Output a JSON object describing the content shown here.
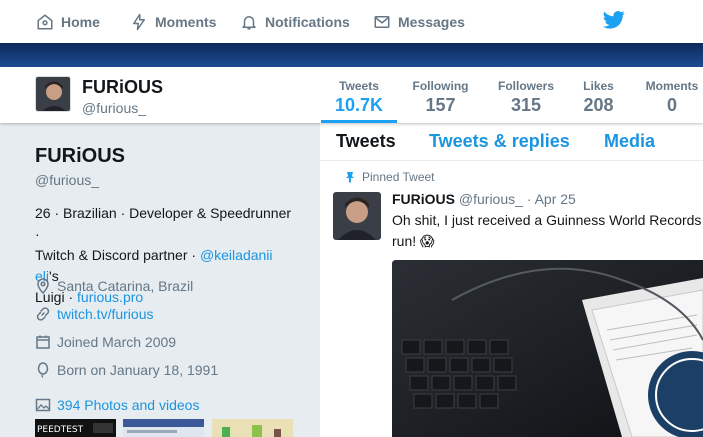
{
  "topnav": {
    "home": "Home",
    "moments": "Moments",
    "notifications": "Notifications",
    "messages": "Messages"
  },
  "profile_nav": {
    "name": "FURiOUS",
    "handle": "@furious_",
    "stats": [
      {
        "label": "Tweets",
        "value": "10.7K"
      },
      {
        "label": "Following",
        "value": "157"
      },
      {
        "label": "Followers",
        "value": "315"
      },
      {
        "label": "Likes",
        "value": "208"
      },
      {
        "label": "Moments",
        "value": "0"
      }
    ]
  },
  "sidebar": {
    "name": "FURiOUS",
    "handle": "@furious_",
    "bio_line1": "26 · Brazilian · Developer & Speedrunner ·",
    "bio_line2_a": "Twitch & Discord partner · ",
    "bio_mention": "@keiladanii eli",
    "bio_line2_b": "'s",
    "bio_line3_a": "Luigi · ",
    "bio_link": "furious.pro",
    "location": "Santa Catarina, Brazil",
    "url": "twitch.tv/furious",
    "joined": "Joined March 2009",
    "born": "Born on January 18, 1991",
    "photos": "394 Photos and videos"
  },
  "tabs": [
    "Tweets",
    "Tweets & replies",
    "Media"
  ],
  "tweet": {
    "pinned_label": "Pinned Tweet",
    "name": "FURiOUS",
    "handle": "@furious_",
    "date": "· Apr 25",
    "text_line1": "Oh shit, I just received a Guinness World Records ce",
    "text_line2": "run! 😱"
  },
  "colors": {
    "accent": "#1da1f2",
    "link": "#1b95e0",
    "banner": "#173e7d"
  }
}
